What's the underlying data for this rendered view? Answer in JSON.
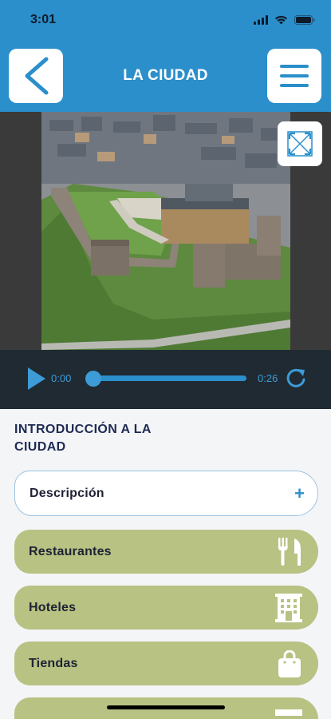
{
  "status": {
    "time": "3:01"
  },
  "header": {
    "title": "LA CIUDAD"
  },
  "audio": {
    "current_time": "0:00",
    "duration": "0:26",
    "progress": 0.0
  },
  "section": {
    "title": "INTRODUCCIÓN A LA CIUDAD"
  },
  "items": [
    {
      "label": "Descripción",
      "icon": "plus-icon"
    },
    {
      "label": "Restaurantes",
      "icon": "fork-knife-icon"
    },
    {
      "label": "Hoteles",
      "icon": "hotel-icon"
    },
    {
      "label": "Tiendas",
      "icon": "shopping-bag-icon"
    },
    {
      "label": "",
      "icon": "hotel-icon"
    }
  ],
  "colors": {
    "header_blue": "#2b8fcb",
    "olive": "#b7c283",
    "audio_bar": "#1f2a32",
    "title_navy": "#1e2a54"
  }
}
